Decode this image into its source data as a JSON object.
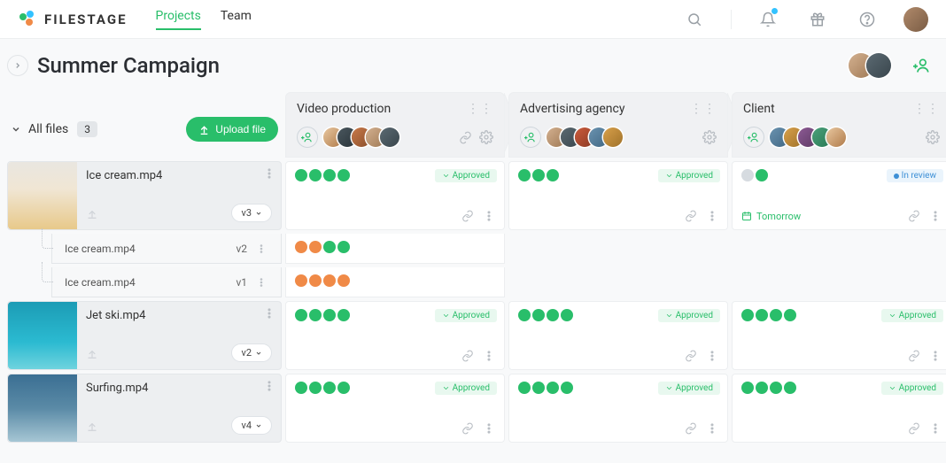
{
  "brand": {
    "name": "FILESTAGE"
  },
  "nav": {
    "projects": "Projects",
    "team": "Team"
  },
  "project": {
    "title": "Summer Campaign"
  },
  "files_panel": {
    "label": "All files",
    "count": "3",
    "upload_label": "Upload file"
  },
  "stages": [
    {
      "name": "Video production",
      "reviewers": 5,
      "show_link": true
    },
    {
      "name": "Advertising agency",
      "reviewers": 5,
      "show_link": false
    },
    {
      "name": "Client",
      "reviewers": 5,
      "show_link": false
    }
  ],
  "status": {
    "approved": "Approved",
    "in_review": "In review"
  },
  "due": {
    "tomorrow": "Tomorrow"
  },
  "files": [
    {
      "name": "Ice cream.mp4",
      "version": "v3",
      "thumb": "cream",
      "history": [
        {
          "name": "Ice cream.mp4",
          "ver": "v2"
        },
        {
          "name": "Ice cream.mp4",
          "ver": "v1"
        }
      ],
      "cells": [
        {
          "dots": [
            "g",
            "g",
            "g",
            "g"
          ],
          "status": "approved"
        },
        {
          "dots": [
            "g",
            "g",
            "g"
          ],
          "status": "approved"
        },
        {
          "dots": [
            "x",
            "g"
          ],
          "status": "review",
          "due": "tomorrow"
        }
      ],
      "history_cells": [
        [
          {
            "dots": [
              "o",
              "o",
              "g",
              "g"
            ]
          },
          null,
          null
        ],
        [
          {
            "dots": [
              "o",
              "o",
              "o",
              "o"
            ]
          },
          null,
          null
        ]
      ]
    },
    {
      "name": "Jet ski.mp4",
      "version": "v2",
      "thumb": "sea",
      "cells": [
        {
          "dots": [
            "g",
            "g",
            "g",
            "g"
          ],
          "status": "approved"
        },
        {
          "dots": [
            "g",
            "g",
            "g",
            "g"
          ],
          "status": "approved"
        },
        {
          "dots": [
            "g",
            "g",
            "g",
            "g"
          ],
          "status": "approved"
        }
      ]
    },
    {
      "name": "Surfing.mp4",
      "version": "v4",
      "thumb": "surf",
      "cells": [
        {
          "dots": [
            "g",
            "g",
            "g",
            "g"
          ],
          "status": "approved"
        },
        {
          "dots": [
            "g",
            "g",
            "g",
            "g"
          ],
          "status": "approved"
        },
        {
          "dots": [
            "g",
            "g",
            "g",
            "g"
          ],
          "status": "approved"
        }
      ]
    }
  ],
  "avatar_colors": [
    [
      "#e8c7a0",
      "#b07b4a"
    ],
    [
      "#4a575e",
      "#2a343a"
    ],
    [
      "#c97a4a",
      "#8a4e2a"
    ],
    [
      "#d3b090",
      "#a07a55"
    ],
    [
      "#5b6a72",
      "#3a464d"
    ],
    [
      "#cc5b3c",
      "#8a3a24"
    ],
    [
      "#6b93b0",
      "#406783"
    ],
    [
      "#d8a04a",
      "#a0722a"
    ],
    [
      "#8c5a94",
      "#5e3a64"
    ],
    [
      "#4aa07a",
      "#2a7a55"
    ]
  ]
}
